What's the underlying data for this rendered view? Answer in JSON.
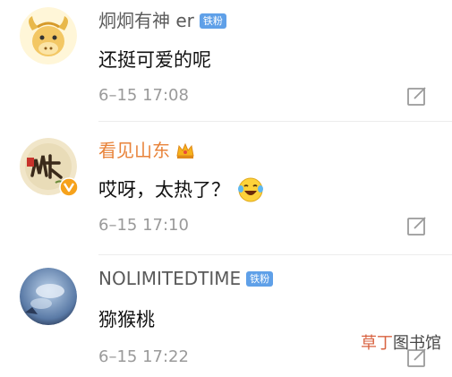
{
  "colors": {
    "name_default": "#5a5a5a",
    "name_vip": "#e8833a",
    "fan_badge": "#5fa0e8",
    "timestamp": "#9a9a9a",
    "watermark_accent": "#d4532d"
  },
  "comments": [
    {
      "username": "炯炯有神 er",
      "badge": "铁粉",
      "text": "还挺可爱的呢",
      "time": "6–15 17:08",
      "avatar_icon": "cartoon-ox-avatar",
      "action_icon": "edit-icon"
    },
    {
      "username": "看见山东",
      "badge_icon": "crown-icon",
      "verified_icon": "verified-v-icon",
      "text": "哎呀，太热了？",
      "emoji_icon": "laughing-tears-emoji",
      "time": "6–15 17:10",
      "avatar_icon": "shandong-calligraphy-avatar",
      "action_icon": "edit-icon"
    },
    {
      "username": "NOLIMITEDTIME",
      "badge": "铁粉",
      "text": "猕猴桃",
      "time": "6–15 17:22",
      "avatar_icon": "sky-clouds-avatar",
      "action_icon": "edit-icon"
    }
  ],
  "watermark": {
    "part1": "草丁",
    "part2": "图书馆"
  }
}
